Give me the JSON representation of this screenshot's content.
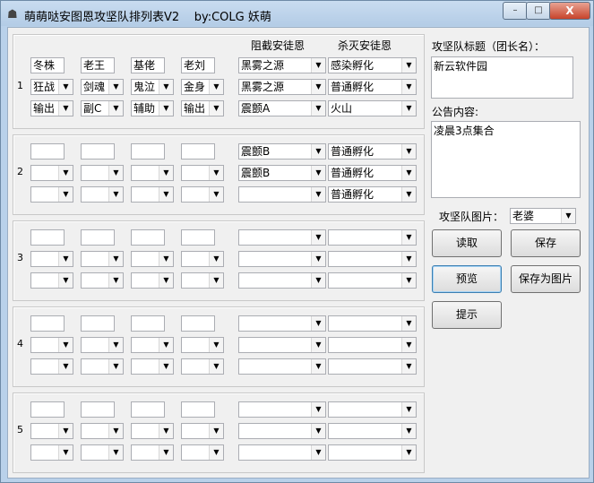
{
  "window": {
    "title": "萌萌哒安图恩攻坚队排列表V2    by:COLG 妖萌",
    "min_label": "–",
    "max_label": "□",
    "close_label": "X"
  },
  "headers": {
    "col1": "阻截安徒恩",
    "col2": "杀灭安徒恩"
  },
  "groups": [
    {
      "num": "1",
      "names": [
        "冬株",
        "老王",
        "基佬",
        "老刘"
      ],
      "roles": [
        "狂战",
        "剑魂",
        "鬼泣",
        "金身"
      ],
      "duties": [
        "输出",
        "副C",
        "辅助",
        "输出"
      ],
      "block": [
        "黑雾之源",
        "黑雾之源",
        "震颤A"
      ],
      "kill": [
        "感染孵化",
        "普通孵化",
        "火山"
      ]
    },
    {
      "num": "2",
      "names": [
        "",
        "",
        "",
        ""
      ],
      "roles": [
        "",
        "",
        "",
        ""
      ],
      "duties": [
        "",
        "",
        "",
        ""
      ],
      "block": [
        "震颤B",
        "震颤B",
        ""
      ],
      "kill": [
        "普通孵化",
        "普通孵化",
        "普通孵化"
      ]
    },
    {
      "num": "3",
      "names": [
        "",
        "",
        "",
        ""
      ],
      "roles": [
        "",
        "",
        "",
        ""
      ],
      "duties": [
        "",
        "",
        "",
        ""
      ],
      "block": [
        "",
        "",
        ""
      ],
      "kill": [
        "",
        "",
        ""
      ]
    },
    {
      "num": "4",
      "names": [
        "",
        "",
        "",
        ""
      ],
      "roles": [
        "",
        "",
        "",
        ""
      ],
      "duties": [
        "",
        "",
        "",
        ""
      ],
      "block": [
        "",
        "",
        ""
      ],
      "kill": [
        "",
        "",
        ""
      ]
    },
    {
      "num": "5",
      "names": [
        "",
        "",
        "",
        ""
      ],
      "roles": [
        "",
        "",
        "",
        ""
      ],
      "duties": [
        "",
        "",
        "",
        ""
      ],
      "block": [
        "",
        "",
        ""
      ],
      "kill": [
        "",
        "",
        ""
      ]
    }
  ],
  "right": {
    "team_title_label": "攻坚队标题（团长名）：",
    "team_title_value": "新云软件园",
    "notice_label": "公告内容:",
    "notice_value": "凌晨3点集合",
    "image_label": "攻坚队图片：",
    "image_value": "老婆",
    "buttons": {
      "read": "读取",
      "save": "保存",
      "preview": "预览",
      "save_image": "保存为图片",
      "hint": "提示"
    }
  }
}
